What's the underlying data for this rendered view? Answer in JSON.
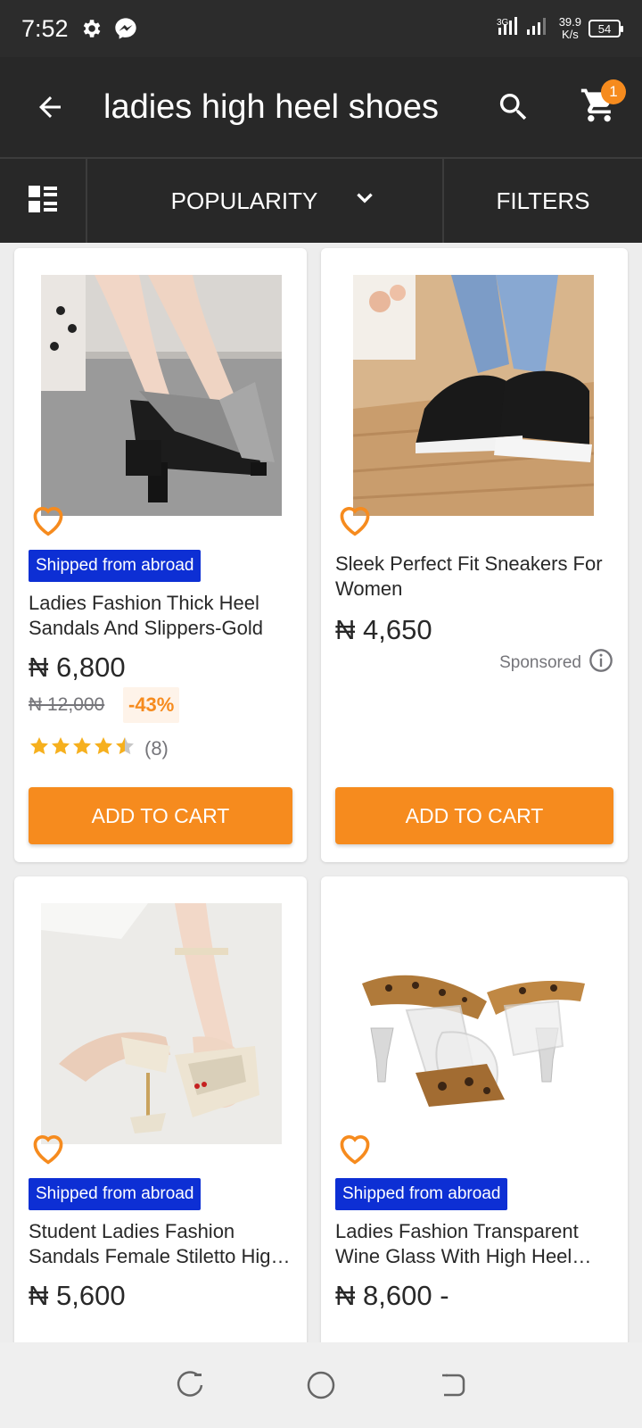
{
  "status_bar": {
    "time": "7:52",
    "net_speed_value": "39.9",
    "net_speed_unit": "K/s",
    "battery": "54"
  },
  "app_bar": {
    "title": "ladies high heel shoes",
    "cart_count": "1"
  },
  "sort_bar": {
    "sort_label": "POPULARITY",
    "filters_label": "FILTERS"
  },
  "products": [
    {
      "badge": "Shipped from abroad",
      "name": "Ladies Fashion Thick Heel Sandals And Slippers-Gold",
      "price": "₦ 6,800",
      "old_price": "₦ 12,000",
      "discount": "-43%",
      "rating_stars": 4.5,
      "rating_count": "(8)",
      "button": "ADD TO CART"
    },
    {
      "name": "Sleek Perfect Fit Sneakers For Women",
      "price": "₦ 4,650",
      "sponsored": "Sponsored",
      "button": "ADD TO CART"
    },
    {
      "badge": "Shipped from abroad",
      "name": "Student Ladies Fashion Sandals Female Stiletto High Heels",
      "price": "₦ 5,600"
    },
    {
      "badge": "Shipped from abroad",
      "name": "Ladies Fashion Transparent Wine Glass With High Heel Sandals",
      "price": "₦ 8,600 -"
    }
  ],
  "colors": {
    "accent": "#f68b1e",
    "badge_blue": "#0d2fd4",
    "header_dark": "#282828"
  }
}
